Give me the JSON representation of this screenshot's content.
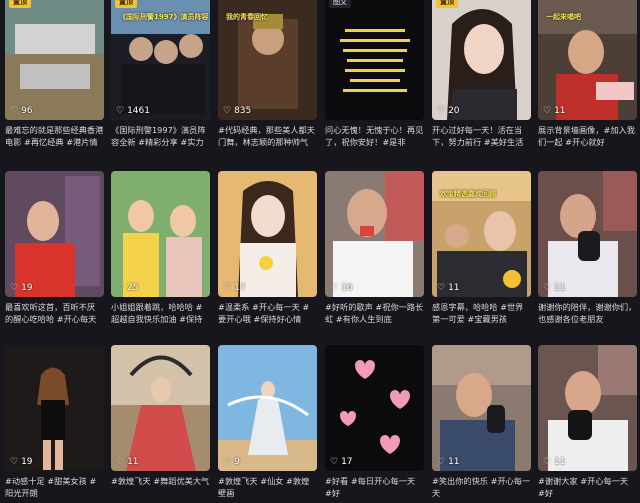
{
  "cards": [
    {
      "likes": "96",
      "badge": "置顶",
      "caption": "最难忘的就是那些经典香港电影 #再忆经典 #港片情怀"
    },
    {
      "likes": "1461",
      "badge": "置顶",
      "overlay": "《国际刑警1997》演员阵容",
      "caption": "《国际刑警1997》演员阵容全新 #精彩分享 #实力派演员"
    },
    {
      "likes": "835",
      "badge": "",
      "overlay": "我的青春回忆",
      "caption": "#代码经典，那些美人都天门舞，林志颖的那种帅气"
    },
    {
      "likes": "",
      "badge": "图文",
      "overlay": "",
      "caption": "问心无愧！无愧于心！再见了，祝你安好！#是非"
    },
    {
      "likes": "20",
      "badge": "置顶",
      "caption": "开心过好每一天！活在当下，努力前行 #美好生活"
    },
    {
      "likes": "11",
      "badge": "",
      "overlay": "一起来唱吧",
      "caption": "展示背景墙画像，#加入我们一起 #开心就好"
    },
    {
      "likes": "19",
      "badge": "",
      "caption": "最喜欢听这首，百听不厌 的醒心吃哈哈 #开心每天"
    },
    {
      "likes": "25",
      "badge": "",
      "caption": "小姐姐跟着跳，哈哈哈 #超越自我快乐加油 #保持"
    },
    {
      "likes": "17",
      "badge": "",
      "caption": "#温柔系 #开心每一天 #要开心哦 #保持好心情"
    },
    {
      "likes": "16",
      "badge": "",
      "caption": "#好听的歌声 #祝你一路长虹 #有你人生到底"
    },
    {
      "likes": "11",
      "badge": "",
      "overlay": "欢宝精选嘉宾回顾",
      "caption": "感恩字幕，哈哈哈 #世界第一可爱 #宝藏男孩"
    },
    {
      "likes": "11",
      "badge": "",
      "caption": "谢谢你的陪伴，谢谢你们，也感谢各位老朋友"
    },
    {
      "likes": "19",
      "badge": "",
      "caption": "#动感十足 #甜美女孩 #阳光开朗"
    },
    {
      "likes": "11",
      "badge": "",
      "caption": "#敦煌飞天 #舞蹈优美大气"
    },
    {
      "likes": "9",
      "badge": "",
      "caption": "#敦煌飞天 #仙女 #敦煌壁画"
    },
    {
      "likes": "17",
      "badge": "",
      "caption": "#好看 #每日开心每一天 #好"
    },
    {
      "likes": "11",
      "badge": "",
      "caption": "#笑出你的快乐 #开心每一天"
    },
    {
      "likes": "11",
      "badge": "",
      "caption": "#谢谢大家 #开心每一天 #好"
    }
  ]
}
